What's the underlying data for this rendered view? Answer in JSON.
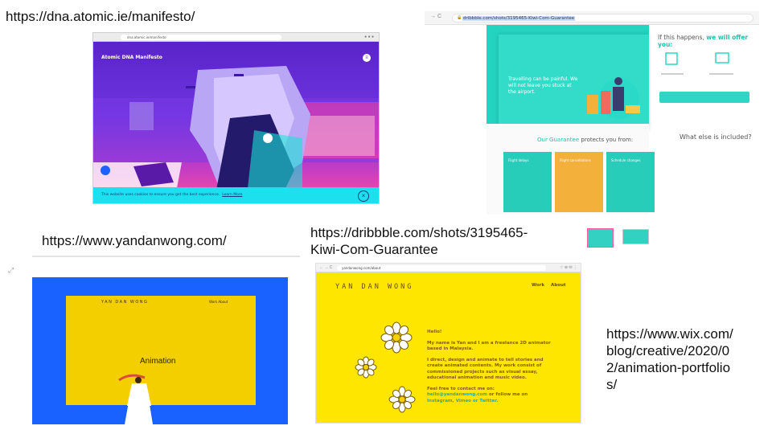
{
  "captions": {
    "atomic_url": "https://dna.atomic.ie/manifesto/",
    "dribbble_url_line1": "https://dribbble.com/shots/3195465-",
    "dribbble_url_line2": "Kiwi-Com-Guarantee",
    "yandanwong_url": "https://www.yandanwong.com/",
    "wix_line1": "https://www.wix.com/",
    "wix_line2": "blog/creative/2020/0",
    "wix_line3": "2/animation-portfolio",
    "wix_line4": "s/"
  },
  "atomic": {
    "address": "dna.atomic.ie/manifesto",
    "logo": "Atomic DNA Manifesto",
    "cookie_text": "This website uses cookies to ensure you get the best experience.",
    "cookie_link": "Learn More",
    "close_glyph": "×",
    "menu_glyph": "≡"
  },
  "dribbble": {
    "nav_glyphs": "→ C",
    "address": "dribbble.com/shots/3195465-Kiwi-Com-Guarantee",
    "hero_text": "Travelling can be painful. We will not leave you stuck at the airport.",
    "offer_prefix": "If this happens,",
    "offer_emphasis": "we will offer you:",
    "guarantee_emphasis": "Our Guarantee",
    "guarantee_rest": "protects you from:",
    "else_title": "What else is included?",
    "tiles": [
      {
        "label": "Flight delays",
        "color": "#28cdb9"
      },
      {
        "label": "Flight cancellations",
        "color": "#f3b03a"
      },
      {
        "label": "Schedule changes",
        "color": "#28cdb9"
      }
    ]
  },
  "yandan_blue": {
    "brand": "YAN DAN WONG",
    "nav": "Work    About",
    "headline": "Animation",
    "expand_glyph": "⤢"
  },
  "yandan_yellow": {
    "nav_glyphs": "← → C",
    "address": "yandanwong.com/about",
    "icons": "☆ ⊕ ✉ ⋮",
    "brand": "YAN DAN WONG",
    "nav_work": "Work",
    "nav_about": "About",
    "hello": "Hello!",
    "para1": "My name is Yan and I am a freelance 2D animator based in Malaysia.",
    "para2": "I direct, design and animate to tell stories and create animated contents. My work consist of commissioned projects such as visual essay, educational animation and music video.",
    "para3_lead": "Feel free to contact me on:",
    "para3_email": "hello@yandanwong.com",
    "para3_mid": "or follow me on",
    "para3_links": "Instagram, Vimeo or Twitter."
  },
  "colors": {
    "atomic_purple": "#5b2ab5",
    "cookie_cyan": "#1de0ee",
    "kiwi_teal": "#25d3c1",
    "yan_blue": "#1a62ff",
    "yan_yellow": "#ffe600"
  }
}
